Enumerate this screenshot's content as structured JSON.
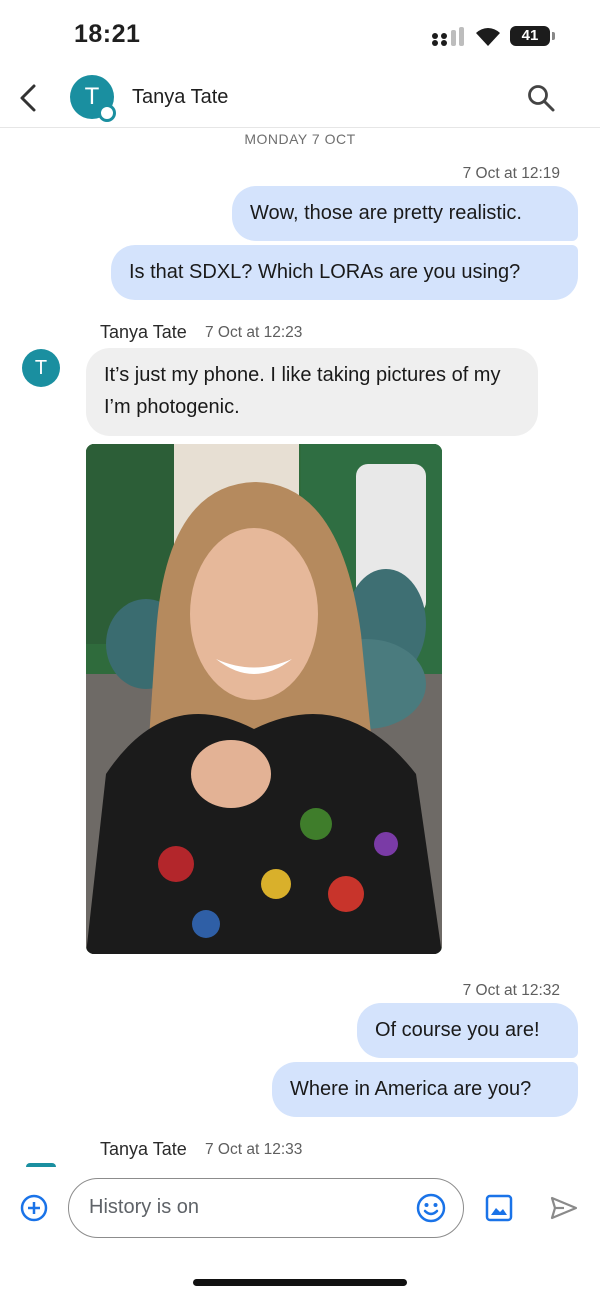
{
  "status_bar": {
    "time": "18:21",
    "battery": "41"
  },
  "header": {
    "contact_name": "Tanya Tate",
    "avatar_initial": "T"
  },
  "conversation": {
    "day_separator": "MONDAY 7 OCT",
    "groups": [
      {
        "timestamp": "7 Oct at 12:19",
        "messages": [
          "Wow, those are pretty realistic.",
          "Is that SDXL? Which LORAs are you using?"
        ]
      },
      {
        "sender": "Tanya Tate",
        "timestamp": "7 Oct at 12:23",
        "messages": [
          "It’s just my phone. I like taking pictures of my I’m photogenic."
        ]
      },
      {
        "timestamp": "7 Oct at 12:32",
        "messages": [
          "Of course you are!",
          "Where in America are you?"
        ]
      },
      {
        "sender": "Tanya Tate",
        "timestamp": "7 Oct at 12:33"
      }
    ]
  },
  "compose": {
    "placeholder": "History is on"
  },
  "colors": {
    "accent": "#1a8fa0",
    "outgoing_bubble": "#d4e3fc",
    "incoming_bubble": "#efefef",
    "icon_blue": "#1a73e8"
  }
}
